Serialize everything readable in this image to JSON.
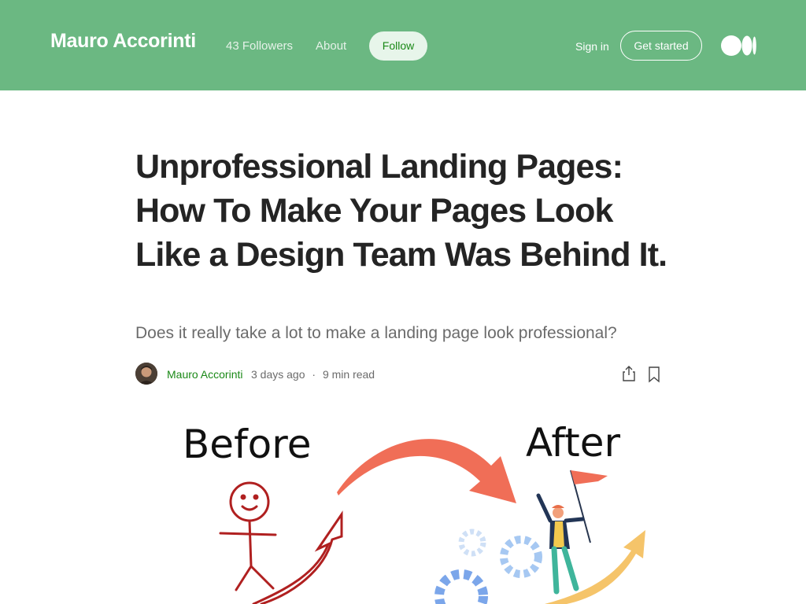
{
  "header": {
    "publication_name": "Mauro Accorinti",
    "followers_label": "43 Followers",
    "about_label": "About",
    "follow_label": "Follow",
    "signin_label": "Sign in",
    "get_started_label": "Get started",
    "logo_icon": "medium-logo-icon",
    "background_color": "#6bb882"
  },
  "article": {
    "title": "Unprofessional Landing Pages: How To Make Your Pages Look Like a Design Team Was Behind It.",
    "subtitle": "Does it really take a lot to make a landing page look professional?",
    "author": "Mauro Accorinti",
    "published": "3 days ago",
    "separator": "·",
    "read_time": "9 min read",
    "share_icon": "share-icon",
    "bookmark_icon": "bookmark-icon",
    "accent_color": "#1a8917"
  },
  "hero_image": {
    "before_label": "Before",
    "after_label": "After"
  }
}
